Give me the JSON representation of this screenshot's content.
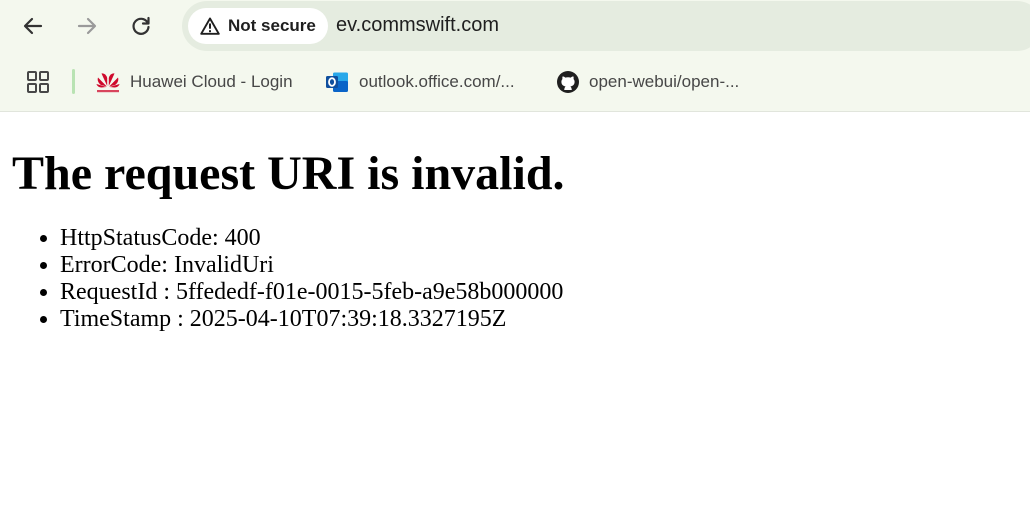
{
  "toolbar": {
    "back_icon": "arrow-left-icon",
    "forward_icon": "arrow-right-icon",
    "reload_icon": "reload-icon",
    "security_icon": "warning-triangle-icon",
    "security_label": "Not secure",
    "url": "ev.commswift.com"
  },
  "bookmarks": {
    "apps_icon": "apps-grid-icon",
    "items": [
      {
        "label": "Huawei Cloud - Login",
        "icon": "huawei-logo-icon"
      },
      {
        "label": "outlook.office.com/...",
        "icon": "outlook-logo-icon"
      },
      {
        "label": "open-webui/open-...",
        "icon": "github-logo-icon"
      }
    ]
  },
  "page": {
    "title": "The request URI is invalid.",
    "details": [
      "HttpStatusCode: 400",
      "ErrorCode: InvalidUri",
      "RequestId : 5ffededf-f01e-0015-5feb-a9e58b000000",
      "TimeStamp : 2025-04-10T07:39:18.3327195Z"
    ]
  },
  "colors": {
    "chrome_background": "#f4f8ee",
    "omnibox_background": "#e5ece0",
    "bookmark_divider": "#b9e3b3",
    "huawei_red": "#cf0a2c",
    "outlook_blue": "#0a64c8"
  }
}
